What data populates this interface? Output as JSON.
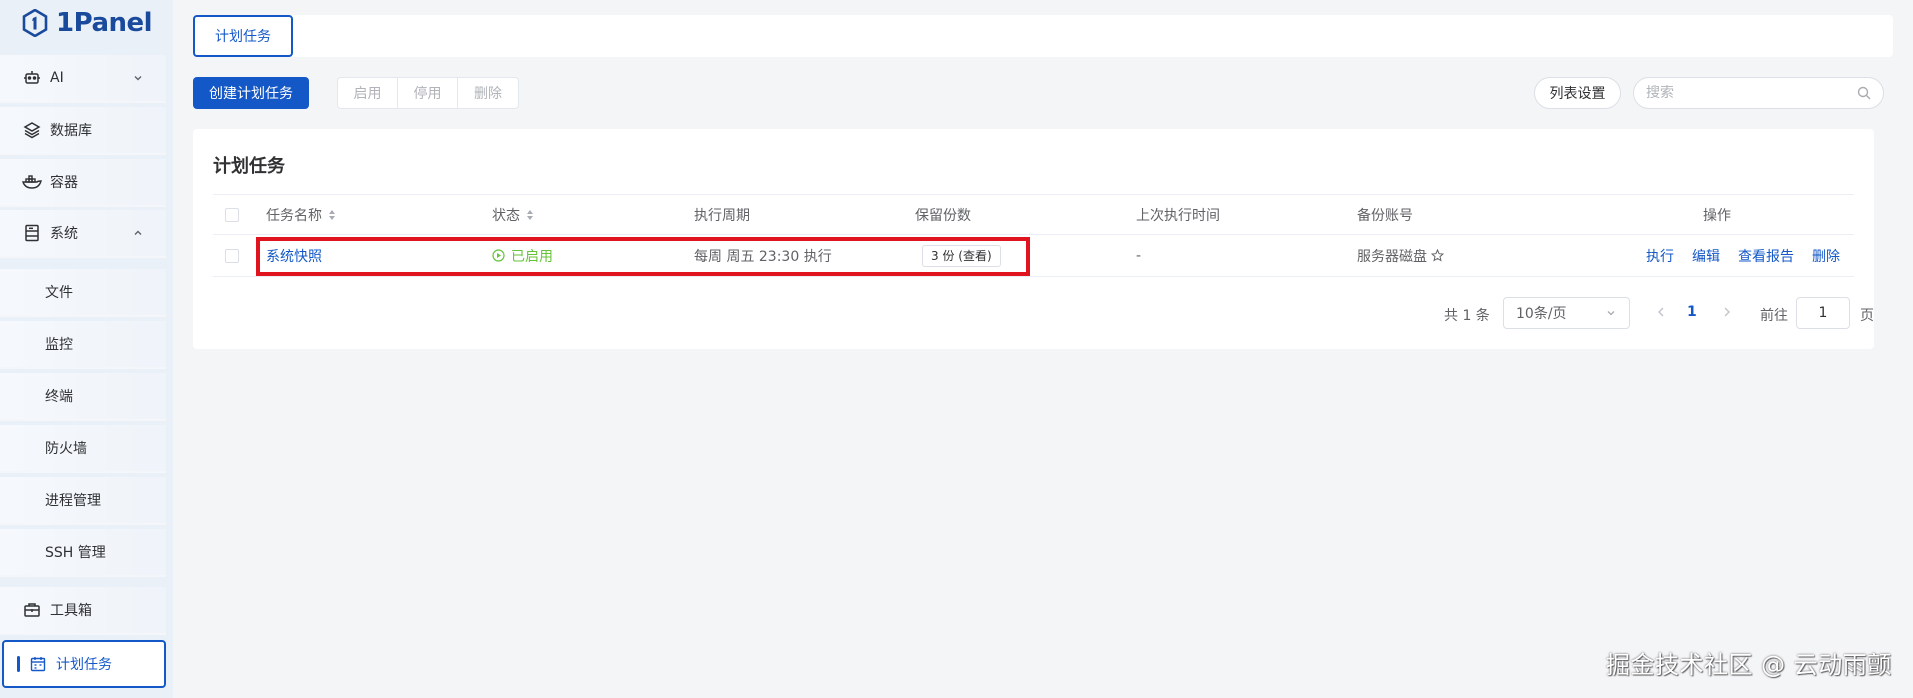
{
  "app": {
    "logo_text": "1Panel"
  },
  "sidebar": {
    "items": [
      {
        "label": "AI",
        "icon": "robot-icon",
        "expandable": true,
        "expanded": false
      },
      {
        "label": "数据库",
        "icon": "layers-icon"
      },
      {
        "label": "容器",
        "icon": "docker-whale-icon"
      },
      {
        "label": "系统",
        "icon": "server-icon",
        "expandable": true,
        "expanded": true
      },
      {
        "label": "文件",
        "sub": true
      },
      {
        "label": "监控",
        "sub": true
      },
      {
        "label": "终端",
        "sub": true
      },
      {
        "label": "防火墙",
        "sub": true
      },
      {
        "label": "进程管理",
        "sub": true
      },
      {
        "label": "SSH 管理",
        "sub": true
      },
      {
        "label": "工具箱",
        "icon": "toolbox-icon"
      },
      {
        "label": "计划任务",
        "icon": "calendar-icon",
        "active": true
      }
    ]
  },
  "tabs": [
    {
      "label": "计划任务",
      "active": true
    }
  ],
  "toolbar": {
    "create_label": "创建计划任务",
    "enable_label": "启用",
    "disable_label": "停用",
    "delete_label": "删除",
    "list_settings_label": "列表设置",
    "search_placeholder": "搜索"
  },
  "card": {
    "title": "计划任务",
    "columns": [
      "任务名称",
      "状态",
      "执行周期",
      "保留份数",
      "上次执行时间",
      "备份账号",
      "操作"
    ],
    "rows": [
      {
        "name": "系统快照",
        "status": "已启用",
        "cycle": "每周 周五 23:30 执行",
        "retain": "3 份 (查看)",
        "last_run": "-",
        "backup_account": "服务器磁盘",
        "actions": [
          "执行",
          "编辑",
          "查看报告",
          "删除"
        ]
      }
    ]
  },
  "pagination": {
    "total": "共 1 条",
    "page_size": "10条/页",
    "current_page": "1",
    "goto_label": "前往",
    "goto_value": "1",
    "page_unit": "页"
  },
  "watermark": "掘金技术社区 @ 云动雨颤",
  "colors": {
    "primary": "#1458c8",
    "success": "#67c23a",
    "highlight": "#e0141e"
  }
}
